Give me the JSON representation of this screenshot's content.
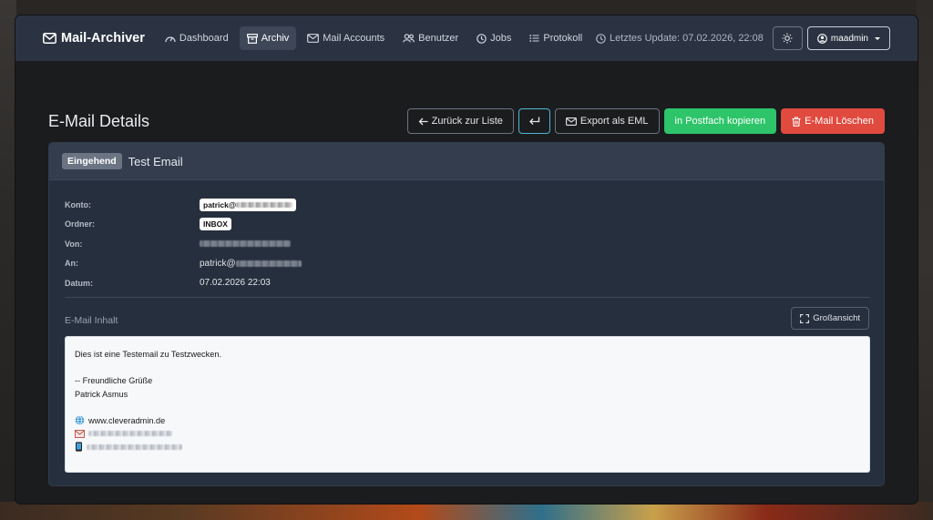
{
  "nav": {
    "brand": "Mail-Archiver",
    "items": [
      {
        "label": "Dashboard",
        "icon": "gauge-icon"
      },
      {
        "label": "Archiv",
        "icon": "archive-icon"
      },
      {
        "label": "Mail Accounts",
        "icon": "mail-accounts-icon"
      },
      {
        "label": "Benutzer",
        "icon": "users-icon"
      },
      {
        "label": "Jobs",
        "icon": "clock-icon"
      },
      {
        "label": "Protokoll",
        "icon": "list-icon"
      }
    ],
    "last_update": "Letztes Update: 07.02.2026, 22:08",
    "user": "maadmin"
  },
  "page": {
    "title": "E-Mail Details",
    "actions": {
      "back": "Zurück zur Liste",
      "export": "Export als EML",
      "copy": "in Postfach kopieren",
      "delete": "E-Mail Löschen"
    }
  },
  "email": {
    "direction": "Eingehend",
    "subject": "Test Email",
    "labels": {
      "account": "Konto:",
      "folder": "Ordner:",
      "from": "Von:",
      "to": "An:",
      "date": "Datum:"
    },
    "account_prefix": "patrick@",
    "folder": "INBOX",
    "to_prefix": "patrick@",
    "date": "07.02.2026 22:03",
    "content_label": "E-Mail Inhalt",
    "fullview": "Großansicht",
    "body": {
      "line1": "Dies ist eine Testemail zu Testzwecken.",
      "line2": "-- Freundliche Grüße",
      "line3": "Patrick Asmus",
      "website": "www.cleveradmin.de"
    }
  },
  "colors": {
    "navbar": "#2b3342",
    "card": "#262f3d",
    "success": "#2ec46a",
    "danger": "#e04a3f",
    "info": "#4fb7d4"
  }
}
